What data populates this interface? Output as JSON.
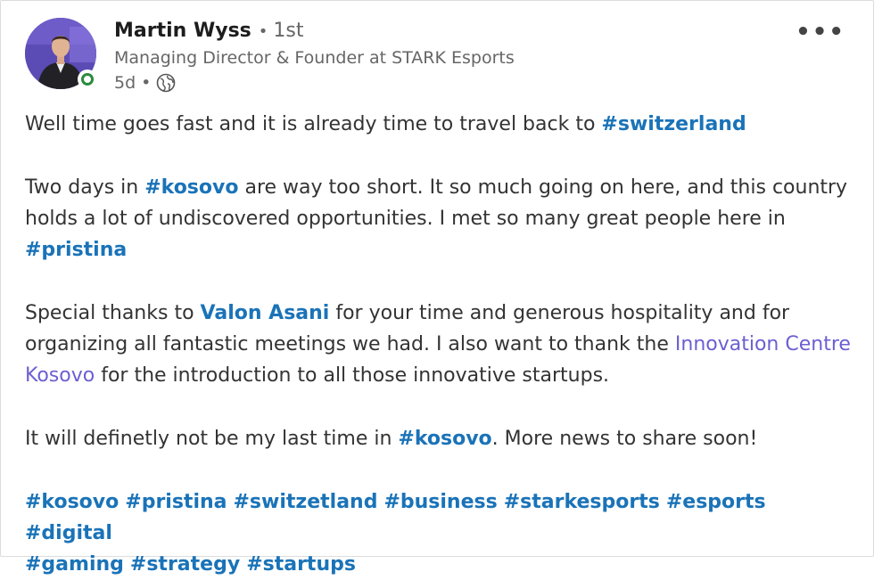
{
  "author": {
    "name": "Martin Wyss",
    "separator": "•",
    "degree": "1st",
    "headline": "Managing Director & Founder at STARK Esports",
    "time": "5d",
    "time_separator": "•",
    "visibility_icon": "globe-icon",
    "status": "online"
  },
  "menu": {
    "label": "•••",
    "icon": "more-options-icon"
  },
  "post": {
    "p1": {
      "text": "Well time goes fast and it is already time to travel back to ",
      "tag": "#switzerland"
    },
    "p2": {
      "t1": "Two days in ",
      "tag1": "#kosovo",
      "t2": " are way too short. It so much going on here, and this country holds a lot of undiscovered opportunities. I met so many great people here in ",
      "tag2": "#pristina"
    },
    "p3": {
      "t1": "Special thanks to ",
      "mention": "Valon Asani",
      "t2": " for your time and generous hospitality and for organizing all fantastic meetings we had. I also want to thank the ",
      "company": "Innovation Centre Kosovo",
      "t3": " for the introduction to all those innovative startups."
    },
    "p4": {
      "t1": "It will definetly not be my last time in ",
      "tag": "#kosovo",
      "t2": ". More news to share soon!"
    },
    "hashtags": [
      "#kosovo",
      "#pristina",
      "#switzetland",
      "#business",
      "#starkesports",
      "#esports",
      "#digital",
      "#gaming",
      "#strategy",
      "#startups"
    ]
  },
  "colors": {
    "link": "#1a73b8",
    "company": "#6b5fd3",
    "presence": "#2b8a3e"
  }
}
